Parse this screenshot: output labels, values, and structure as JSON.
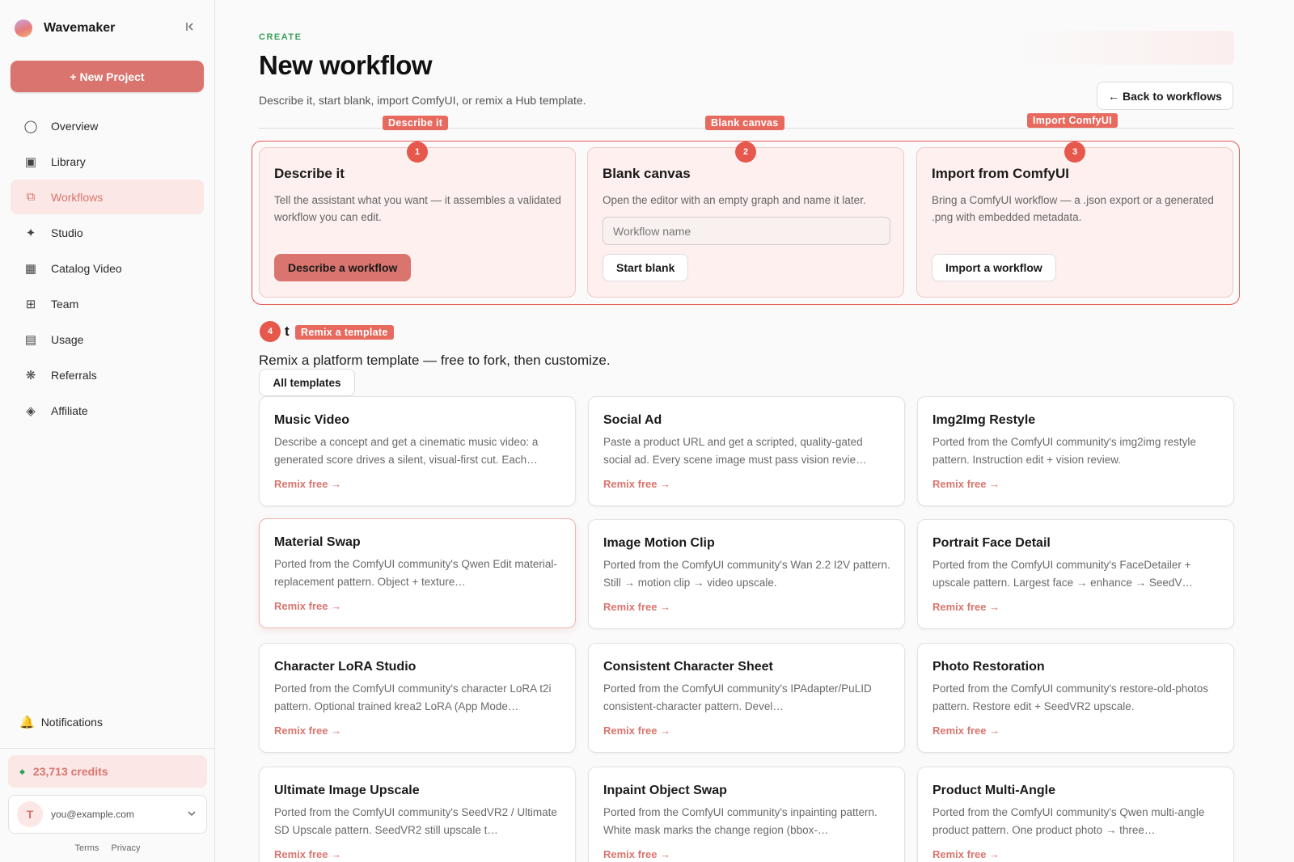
{
  "sidebar": {
    "brand": "Wavemaker",
    "collapse_icon": "collapse-left-icon",
    "new_project": "+ New Project",
    "items": [
      {
        "label": "Overview",
        "icon": "◯"
      },
      {
        "label": "Library",
        "icon": "▣"
      },
      {
        "label": "Workflows",
        "icon": "⧉",
        "active": true
      },
      {
        "label": "Studio",
        "icon": "✦"
      },
      {
        "label": "Catalog Video",
        "icon": "▦"
      },
      {
        "label": "Team",
        "icon": "⊞"
      },
      {
        "label": "Usage",
        "icon": "▤"
      },
      {
        "label": "Referrals",
        "icon": "❋"
      },
      {
        "label": "Affiliate",
        "icon": "◈"
      }
    ],
    "notifications": "Notifications",
    "credits": "23,713 credits",
    "account": {
      "initial": "T",
      "email": "you@example.com"
    },
    "legal": {
      "terms": "Terms",
      "privacy": "Privacy"
    }
  },
  "header": {
    "eyebrow": "CREATE",
    "title": "New workflow",
    "subtitle": "Describe it, start blank, import ComfyUI, or remix a Hub template.",
    "back": "← Back to workflows"
  },
  "tags": {
    "describe": "Describe it",
    "blank": "Blank canvas",
    "import": "Import ComfyUI",
    "remix": "Remix a template"
  },
  "markers": [
    "1",
    "2",
    "3",
    "4"
  ],
  "start_cards": {
    "describe": {
      "title": "Describe it",
      "desc": "Tell the assistant what you want — it assembles a validated workflow you can edit.",
      "button": "Describe a workflow"
    },
    "blank": {
      "title": "Blank canvas",
      "desc": "Open the editor with an empty graph and name it later.",
      "placeholder": "Workflow name",
      "button": "Start blank"
    },
    "import": {
      "title": "Import from ComfyUI",
      "desc": "Bring a ComfyUI workflow — a .json export or a generated .png with embedded metadata.",
      "button": "Import a workflow"
    }
  },
  "remix": {
    "heading_fragment": "t",
    "subtitle": "Remix a platform template — free to fork, then customize.",
    "filter": "All templates",
    "link": "Remix free →",
    "templates": [
      {
        "title": "Music Video",
        "desc": "Describe a concept and get a cinematic music video: a generated score drives a silent, visual-first cut. Each…"
      },
      {
        "title": "Social Ad",
        "desc": "Paste a product URL and get a scripted, quality-gated social ad. Every scene image must pass vision revie…"
      },
      {
        "title": "Img2Img Restyle",
        "desc": "Ported from the ComfyUI community's img2img restyle pattern. Instruction edit + vision review."
      },
      {
        "title": "Material Swap",
        "desc": "Ported from the ComfyUI community's Qwen Edit material-replacement pattern. Object + texture…"
      },
      {
        "title": "Image Motion Clip",
        "desc": "Ported from the ComfyUI community's Wan 2.2 I2V pattern. Still → motion clip → video upscale."
      },
      {
        "title": "Portrait Face Detail",
        "desc": "Ported from the ComfyUI community's FaceDetailer + upscale pattern. Largest face → enhance → SeedV…"
      },
      {
        "title": "Character LoRA Studio",
        "desc": "Ported from the ComfyUI community's character LoRA t2i pattern. Optional trained krea2 LoRA (App Mode…"
      },
      {
        "title": "Consistent Character Sheet",
        "desc": "Ported from the ComfyUI community's IPAdapter/PuLID consistent-character pattern. Devel…"
      },
      {
        "title": "Photo Restoration",
        "desc": "Ported from the ComfyUI community's restore-old-photos pattern. Restore edit + SeedVR2 upscale."
      },
      {
        "title": "Ultimate Image Upscale",
        "desc": "Ported from the ComfyUI community's SeedVR2 / Ultimate SD Upscale pattern. SeedVR2 still upscale t…"
      },
      {
        "title": "Inpaint Object Swap",
        "desc": "Ported from the ComfyUI community's inpainting pattern. White mask marks the change region (bbox-…"
      },
      {
        "title": "Product Multi-Angle",
        "desc": "Ported from the ComfyUI community's Qwen multi-angle product pattern. One product photo → three…"
      }
    ]
  }
}
